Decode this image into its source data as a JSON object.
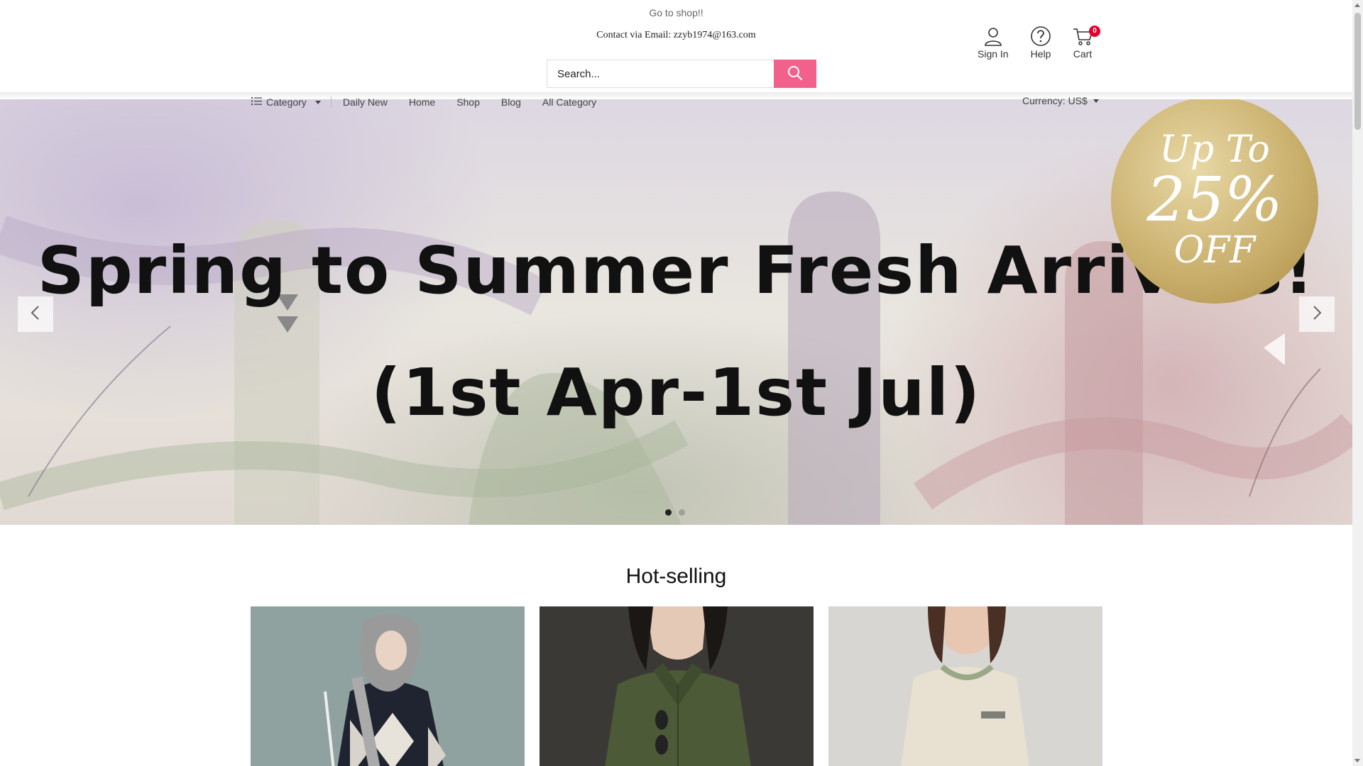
{
  "header": {
    "promo": "Go to shop!!",
    "contact": "Contact via Email: zzyb1974@163.com",
    "search_placeholder": "Search...",
    "sign_in": "Sign In",
    "help": "Help",
    "cart": "Cart",
    "cart_count": "0"
  },
  "nav": {
    "category": "Category",
    "links": [
      "Daily New",
      "Home",
      "Shop",
      "Blog",
      "All Category"
    ],
    "currency": "Currency: US$"
  },
  "banner": {
    "title": "Spring to Summer Fresh Arrivals!",
    "subtitle": "(1st Apr-1st Jul)",
    "badge_line1": "Up To",
    "badge_line2": "25%",
    "badge_line3": "OFF",
    "active_slide": 1,
    "slide_count": 2
  },
  "hot_selling": {
    "title": "Hot-selling"
  },
  "colors": {
    "accent": "#f2618c",
    "cart_badge": "#e4002b"
  }
}
